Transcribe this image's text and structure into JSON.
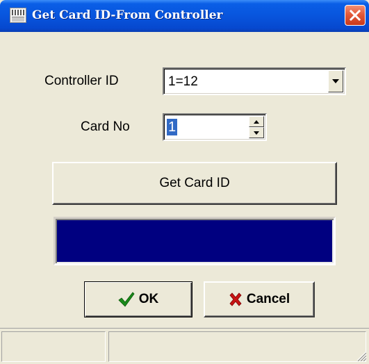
{
  "window": {
    "title": "Get Card ID-From Controller",
    "title_bar_color": "#0855dd",
    "close_button_color": "#e35a3b"
  },
  "form": {
    "controller_id_label": "Controller ID",
    "controller_id_value": "1=12",
    "card_no_label": "Card No",
    "card_no_value": "1"
  },
  "buttons": {
    "get_card_id": "Get Card ID",
    "ok": "OK",
    "cancel": "Cancel"
  },
  "result": {
    "background_color": "#000080",
    "text": ""
  },
  "statusbar": {
    "panel1": "",
    "panel2": ""
  },
  "icons": {
    "app": "app-icon",
    "close": "close-icon",
    "dropdown": "chevron-down-icon",
    "spin_up": "spin-up-icon",
    "spin_down": "spin-down-icon",
    "ok": "check-icon",
    "cancel": "x-icon",
    "grip": "resize-grip-icon"
  }
}
